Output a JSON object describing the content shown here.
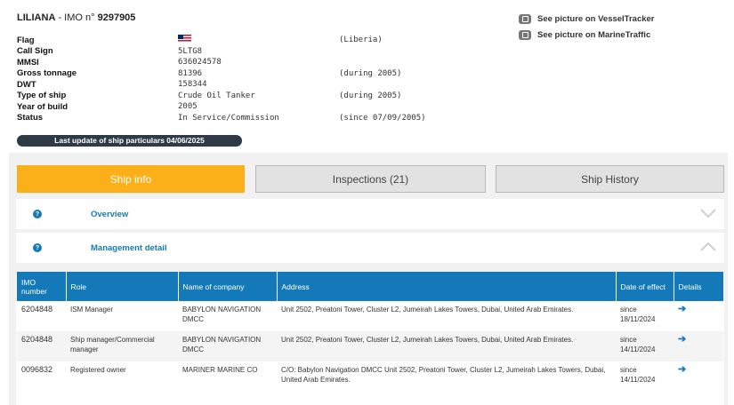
{
  "header": {
    "name": "LILIANA",
    "imo_prefix": "- IMO n°",
    "imo": "9297905",
    "links": [
      {
        "label": "See picture on VesselTracker"
      },
      {
        "label": "See picture on MarineTraffic"
      }
    ]
  },
  "particulars": {
    "flag_label": "Flag",
    "flag_country": "(Liberia)",
    "callsign_label": "Call Sign",
    "callsign": "5LTG8",
    "mmsi_label": "MMSI",
    "mmsi": "636024578",
    "gt_label": "Gross tonnage",
    "gt": "81396",
    "gt_note": "(during 2005)",
    "dwt_label": "DWT",
    "dwt": "158344",
    "type_label": "Type of ship",
    "type": "Crude Oil Tanker",
    "type_note": "(during 2005)",
    "year_label": "Year of build",
    "year": "2005",
    "status_label": "Status",
    "status": "In Service/Commission",
    "status_note": "(since 07/09/2005)"
  },
  "last_update": "Last update of ship particulars 04/06/2025",
  "tabs": {
    "ship_info": "Ship info",
    "inspections": "Inspections (21)",
    "history": "Ship History"
  },
  "sections": {
    "overview": "Overview",
    "management": "Management detail"
  },
  "management_table": {
    "headers": {
      "imo": "IMO number",
      "role": "Role",
      "company": "Name of company",
      "address": "Address",
      "date": "Date of effect",
      "details": "Details"
    },
    "rows": [
      {
        "imo": "6204848",
        "role": "ISM Manager",
        "company": "BABYLON NAVIGATION DMCC",
        "address": "Unit 2502, Preatoni Tower, Cluster L2, Jumeirah Lakes Towers, Dubai, United Arab Emirates.",
        "since": "since",
        "date": "18/11/2024"
      },
      {
        "imo": "6204848",
        "role": "Ship manager/Commercial manager",
        "company": "BABYLON NAVIGATION DMCC",
        "address": "Unit 2502, Preatoni Tower, Cluster L2, Jumeirah Lakes Towers, Dubai, United Arab Emirates.",
        "since": "since",
        "date": "14/11/2024"
      },
      {
        "imo": "0096832",
        "role": "Registered owner",
        "company": "MARINER MARINE CO",
        "address": "C/O: Babylon Navigation DMCC Unit 2502, Preatoni Tower, Cluster L2, Jumeirah Lakes Towers, Dubai, United Arab Emirates.",
        "since": "since",
        "date": "14/11/2024"
      }
    ]
  }
}
